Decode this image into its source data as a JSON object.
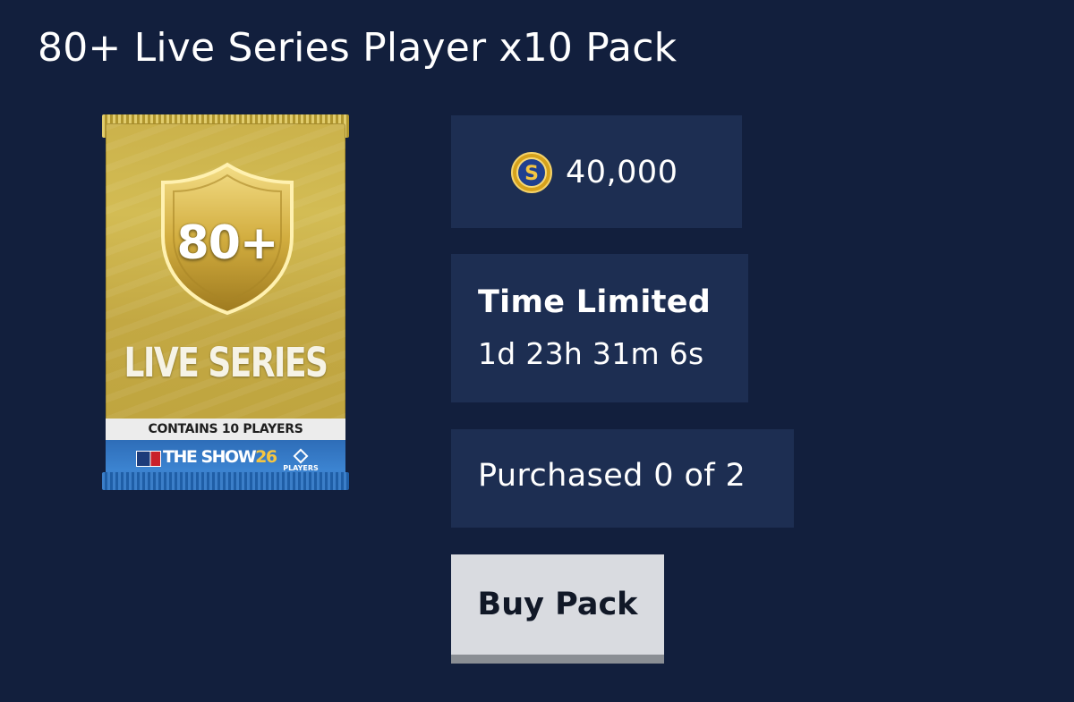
{
  "page": {
    "title": "80+ Live Series Player x10 Pack"
  },
  "pack_art": {
    "rating_badge": "80+",
    "series_name": "LIVE SERIES",
    "contents_banner": "CONTAINS 10 PLAYERS",
    "game_logo_text": "THE SHOW",
    "game_logo_number": "26",
    "players_logo_text": "PLAYERS",
    "colors": {
      "foil_gold": "#cbb24b",
      "footer_blue": "#3c84d1"
    }
  },
  "price": {
    "currency_icon": "stubs-coin-icon",
    "currency_symbol": "S",
    "amount": "40,000"
  },
  "availability": {
    "label": "Time Limited",
    "time_remaining": "1d 23h 31m 6s"
  },
  "purchase_limit": {
    "text": "Purchased 0 of 2"
  },
  "actions": {
    "buy_label": "Buy Pack"
  },
  "theme": {
    "background": "#121f3d",
    "card_background": "#1d2e52",
    "button_background": "#d9dbe0",
    "button_shadow": "#8a8e94",
    "coin_gold": "#d6a21c",
    "coin_blue": "#1f3f8f"
  }
}
